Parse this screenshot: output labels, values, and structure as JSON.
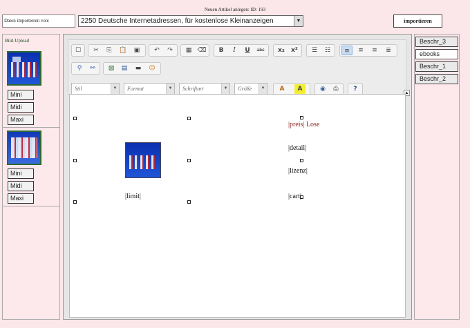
{
  "header": {
    "note": "Neuen Artikel anlegen: ID: 193"
  },
  "import": {
    "label": "Daten importieren von:",
    "selected": "2250 Deutsche Internetadressen, für kostenlose Kleinanzeigen",
    "button": "importieren"
  },
  "left_panel": {
    "upload_label": "Bild-Upload",
    "groups": [
      {
        "image": "product-thumbnail-1",
        "buttons": [
          "Mini",
          "Midi",
          "Maxi"
        ]
      },
      {
        "image": "product-thumbnail-2",
        "buttons": [
          "Mini",
          "Midi",
          "Maxi"
        ]
      }
    ]
  },
  "toolbar": {
    "combos": {
      "style": "Stil",
      "format": "Format",
      "font": "Schriftart",
      "size": "Größe"
    },
    "icons": [
      "source-icon",
      "cut-icon",
      "copy-icon",
      "paste-icon",
      "paste-word-icon",
      "undo-icon",
      "redo-icon",
      "select-all-icon",
      "eraser-icon",
      "bold-icon",
      "italic-icon",
      "underline-icon",
      "strike-icon",
      "subscript-icon",
      "superscript-icon",
      "ordered-list-icon",
      "unordered-list-icon",
      "align-left-icon",
      "align-center-icon",
      "align-right-icon",
      "justify-icon",
      "find-icon",
      "replace-icon",
      "image-icon",
      "table-icon",
      "rule-icon",
      "smiley-icon",
      "text-color-icon",
      "bg-color-icon",
      "globe-icon",
      "preview-icon",
      "help-icon"
    ],
    "bold_glyph": "B",
    "italic_glyph": "I",
    "underline_glyph": "U",
    "strike_glyph": "abc",
    "sub_glyph": "x₂",
    "sup_glyph": "x²",
    "textcolor_glyph": "A",
    "bgcolor_glyph": "A",
    "help_glyph": "?"
  },
  "content": {
    "price": "|preis| Lose",
    "detail": "|detail|",
    "license": "|lizenz|",
    "limit": "|limit|",
    "cart": "|cart|"
  },
  "right_tabs": [
    "Beschr_3",
    "ebooks",
    "Beschr_1",
    "Beschr_2"
  ],
  "colors": {
    "background": "#fbe7ea",
    "accent_green": "#2d6b2d",
    "price_text": "#8a1f1f"
  }
}
